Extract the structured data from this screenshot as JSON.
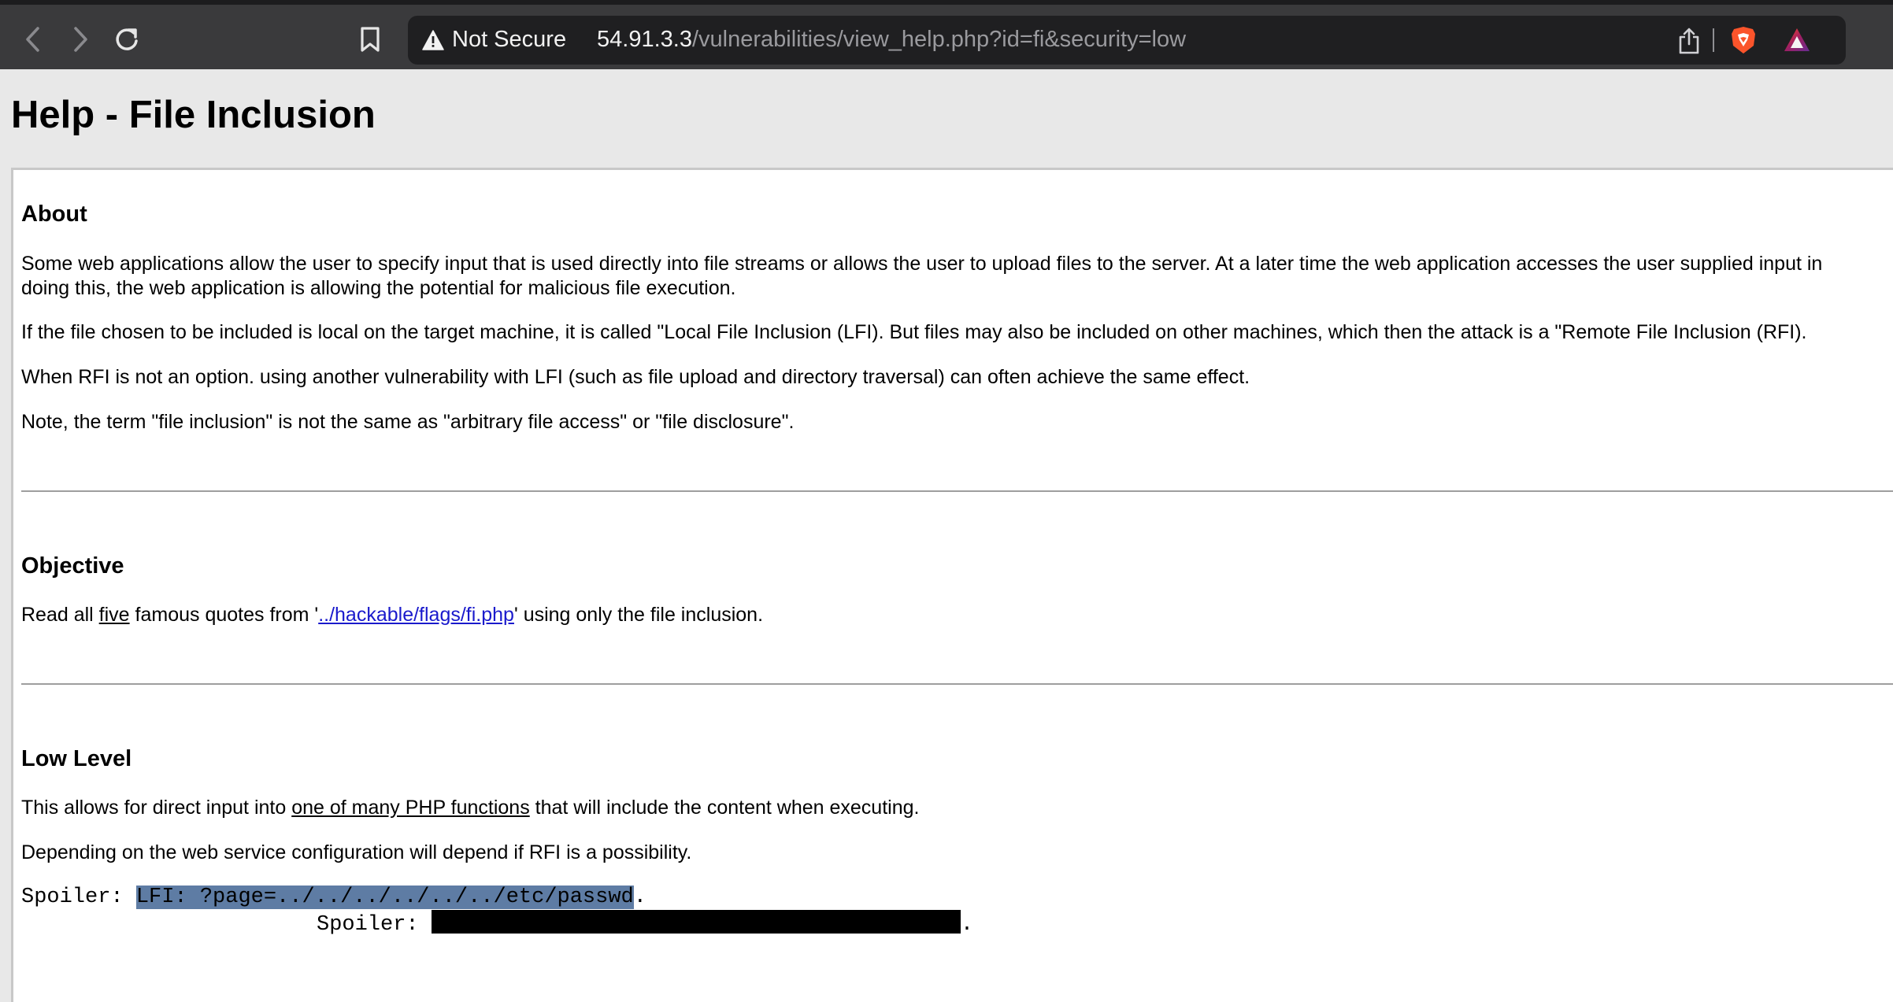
{
  "browser": {
    "security_label": "Not Secure",
    "url_host": "54.91.3.3",
    "url_path": "/vulnerabilities/view_help.php?id=fi&security=low"
  },
  "page": {
    "title": "Help - File Inclusion",
    "about": {
      "heading": "About",
      "p1_line1": "Some web applications allow the user to specify input that is used directly into file streams or allows the user to upload files to the server. At a later time the web application accesses the user supplied input in",
      "p1_line2": "doing this, the web application is allowing the potential for malicious file execution.",
      "p2": "If the file chosen to be included is local on the target machine, it is called \"Local File Inclusion (LFI). But files may also be included on other machines, which then the attack is a \"Remote File Inclusion (RFI).",
      "p3": "When RFI is not an option. using another vulnerability with LFI (such as file upload and directory traversal) can often achieve the same effect.",
      "p4": "Note, the term \"file inclusion\" is not the same as \"arbitrary file access\" or \"file disclosure\"."
    },
    "objective": {
      "heading": "Objective",
      "text_before": "Read all ",
      "five": "five",
      "text_middle": " famous quotes from '",
      "link": "../hackable/flags/fi.php",
      "text_after": "' using only the file inclusion."
    },
    "low_level": {
      "heading": "Low Level",
      "p1_before": "This allows for direct input into ",
      "p1_link": "one of many PHP functions",
      "p1_after": " that will include the content when executing.",
      "p2": "Depending on the web service configuration will depend if RFI is a possibility.",
      "spoiler_label": "Spoiler: ",
      "spoiler1": "LFI: ?page=../../../../../../etc/passwd",
      "spoiler_end": ".",
      "spoiler2_label": "Spoiler: ",
      "spoiler2_end": "."
    }
  }
}
